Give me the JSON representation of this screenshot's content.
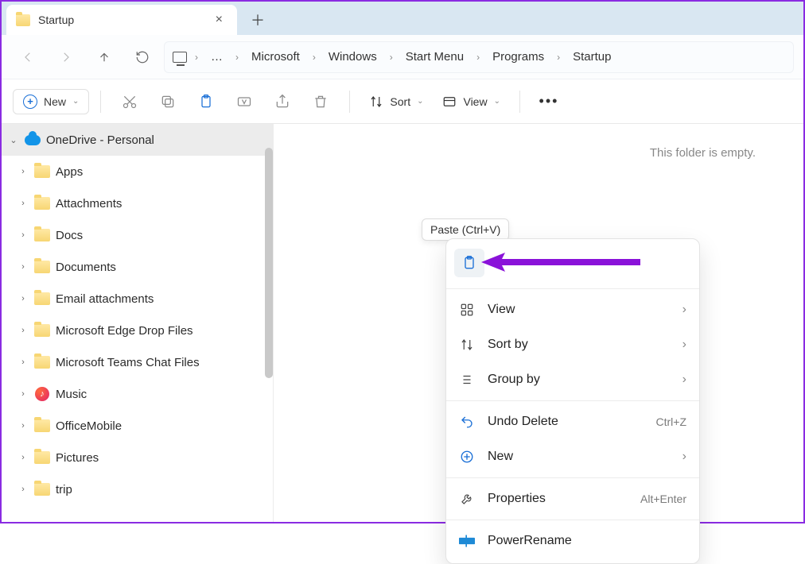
{
  "tab": {
    "title": "Startup"
  },
  "breadcrumb": [
    "Microsoft",
    "Windows",
    "Start Menu",
    "Programs",
    "Startup"
  ],
  "toolbar": {
    "new_label": "New",
    "sort_label": "Sort",
    "view_label": "View"
  },
  "sidebar": {
    "header": "OneDrive - Personal",
    "items": [
      {
        "label": "Apps",
        "icon": "folder"
      },
      {
        "label": "Attachments",
        "icon": "folder"
      },
      {
        "label": "Docs",
        "icon": "folder"
      },
      {
        "label": "Documents",
        "icon": "folder"
      },
      {
        "label": "Email attachments",
        "icon": "folder"
      },
      {
        "label": "Microsoft Edge Drop Files",
        "icon": "folder"
      },
      {
        "label": "Microsoft Teams Chat Files",
        "icon": "folder"
      },
      {
        "label": "Music",
        "icon": "music"
      },
      {
        "label": "OfficeMobile",
        "icon": "folder"
      },
      {
        "label": "Pictures",
        "icon": "folder"
      },
      {
        "label": "trip",
        "icon": "folder"
      }
    ]
  },
  "content": {
    "empty_message": "This folder is empty."
  },
  "tooltip": {
    "paste": "Paste (Ctrl+V)"
  },
  "context_menu": {
    "view": "View",
    "sort_by": "Sort by",
    "group_by": "Group by",
    "undo": "Undo Delete",
    "undo_shortcut": "Ctrl+Z",
    "new": "New",
    "properties": "Properties",
    "properties_shortcut": "Alt+Enter",
    "powerrename": "PowerRename"
  }
}
